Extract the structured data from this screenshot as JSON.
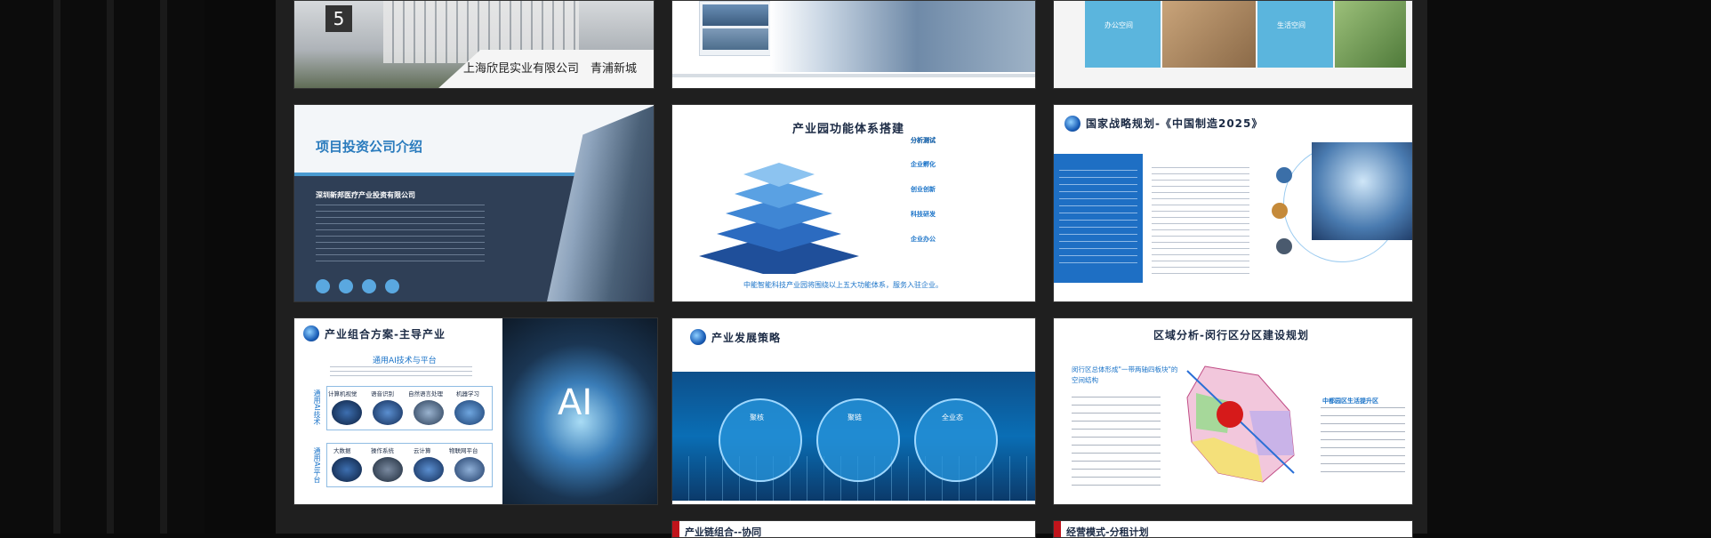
{
  "slides": {
    "s1": {
      "caption": "上海欣昆实业有限公司　青浦新城"
    },
    "s3": {
      "office_label": "办公空间",
      "living_label": "生活空间"
    },
    "s4": {
      "title": "项目投资公司介绍",
      "company": "深圳新邦医疗产业投资有限公司"
    },
    "s5": {
      "title": "产业园功能体系搭建",
      "items": [
        "分析测试",
        "企业孵化",
        "创业创新",
        "科技研发",
        "企业办公"
      ],
      "footer": "中能智能科技产业园将围绕以上五大功能体系，服务入驻企业。"
    },
    "s6": {
      "title": "国家战略规划-《中国制造2025》"
    },
    "s7": {
      "title": "产业组合方案-主导产业",
      "subtitle": "通用AI技术与平台",
      "left_label_top": "通用AI技术",
      "left_label_bottom": "通用AI平台",
      "tech": [
        "计算机视觉",
        "语音识别",
        "自然语言处理",
        "机器学习"
      ],
      "platform": [
        "大数据",
        "操作系统",
        "云计算",
        "物联网平台"
      ],
      "ai": "AI"
    },
    "s8": {
      "title": "产业发展策略",
      "circles": [
        "聚核",
        "聚链",
        "全业态"
      ]
    },
    "s9": {
      "title": "区域分析-闵行区分区建设规划",
      "left_head": "闵行区总体形成\"一带两轴四板块\"的空间结构",
      "right_head": "中都园区生活提升区"
    },
    "s10": {
      "title": "产业链组合--协同"
    },
    "s11": {
      "title": "经营模式-分租计划"
    }
  }
}
